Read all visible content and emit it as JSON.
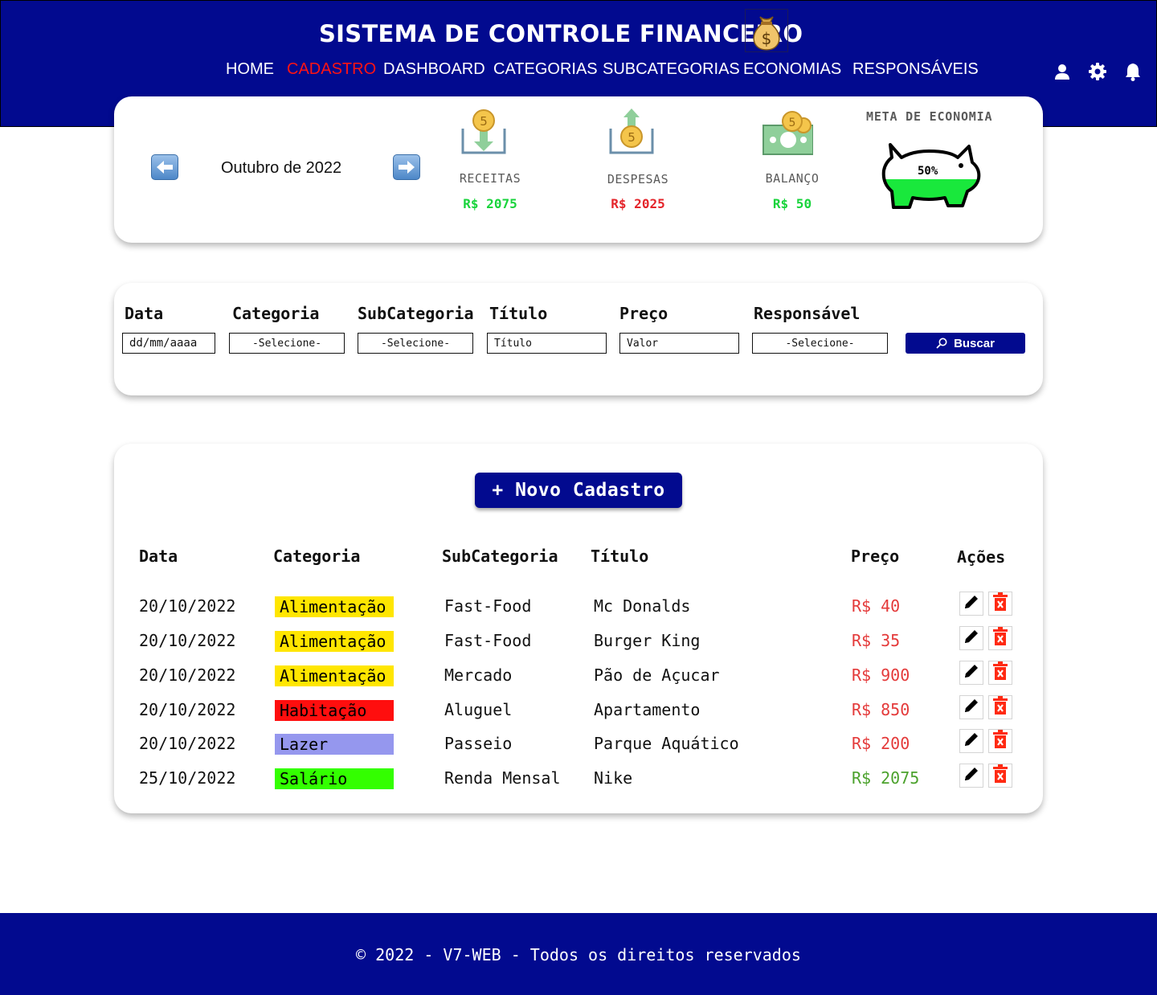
{
  "header": {
    "title": "SISTEMA DE CONTROLE FINANCEIRO",
    "nav": [
      "HOME",
      "CADASTRO",
      "DASHBOARD",
      "CATEGORIAS",
      "SUBCATEGORIAS",
      "ECONOMIAS",
      "RESPONSÁVEIS"
    ],
    "active_nav": "CADASTRO",
    "icons": [
      "user-icon",
      "gear-icon",
      "bell-icon"
    ]
  },
  "summary": {
    "month": "Outubro de 2022",
    "receitas": {
      "label": "RECEITAS",
      "value": "R$ 2075",
      "color": "#19d43c"
    },
    "despesas": {
      "label": "DESPESAS",
      "value": "R$ 2025",
      "color": "#e4252b"
    },
    "balanco": {
      "label": "BALANÇO",
      "value": "R$ 50",
      "color": "#19d43c"
    },
    "meta": {
      "label": "META DE ECONOMIA",
      "percent_text": "50%",
      "fill_fraction": 0.5,
      "fill_color": "#19e83c"
    }
  },
  "filter": {
    "labels": {
      "data": "Data",
      "categoria": "Categoria",
      "subcategoria": "SubCategoria",
      "titulo": "Título",
      "preco": "Preço",
      "responsavel": "Responsável"
    },
    "data_value": "dd/mm/aaaa",
    "categoria_value": "-Selecione-",
    "subcategoria_value": "-Selecione-",
    "titulo_placeholder": "Título",
    "preco_placeholder": "Valor",
    "responsavel_value": "-Selecione-",
    "search_label": "Buscar"
  },
  "table": {
    "new_button": "+ Novo Cadastro",
    "headers": {
      "data": "Data",
      "categoria": "Categoria",
      "subcategoria": "SubCategoria",
      "titulo": "Título",
      "preco": "Preço",
      "acoes": "Ações"
    },
    "rows": [
      {
        "data": "20/10/2022",
        "categoria": "Alimentação",
        "categoria_color": "#ffe600",
        "subcategoria": "Fast-Food",
        "titulo": "Mc Donalds",
        "preco": "R$ 40",
        "income": false
      },
      {
        "data": "20/10/2022",
        "categoria": "Alimentação",
        "categoria_color": "#ffe600",
        "subcategoria": "Fast-Food",
        "titulo": "Burger King",
        "preco": "R$ 35",
        "income": false
      },
      {
        "data": "20/10/2022",
        "categoria": "Alimentação",
        "categoria_color": "#ffe600",
        "subcategoria": "Mercado",
        "titulo": "Pão de Açucar",
        "preco": "R$ 900",
        "income": false
      },
      {
        "data": "20/10/2022",
        "categoria": "Habitação",
        "categoria_color": "#ff0e0e",
        "subcategoria": "Aluguel",
        "titulo": "Apartamento",
        "preco": "R$ 850",
        "income": false
      },
      {
        "data": "20/10/2022",
        "categoria": "Lazer",
        "categoria_color": "#9597ee",
        "subcategoria": "Passeio",
        "titulo": "Parque Aquático",
        "preco": "R$ 200",
        "income": false
      },
      {
        "data": "25/10/2022",
        "categoria": "Salário",
        "categoria_color": "#33ff00",
        "subcategoria": "Renda Mensal",
        "titulo": "Nike",
        "preco": "R$ 2075",
        "income": true
      }
    ]
  },
  "footer": {
    "text": "© 2022 - V7-WEB - Todos os direitos reservados"
  },
  "colors": {
    "brand": "#020a8f",
    "active_nav": "#ff1414",
    "expense": "#e43a3a",
    "income": "#4ca22d"
  }
}
